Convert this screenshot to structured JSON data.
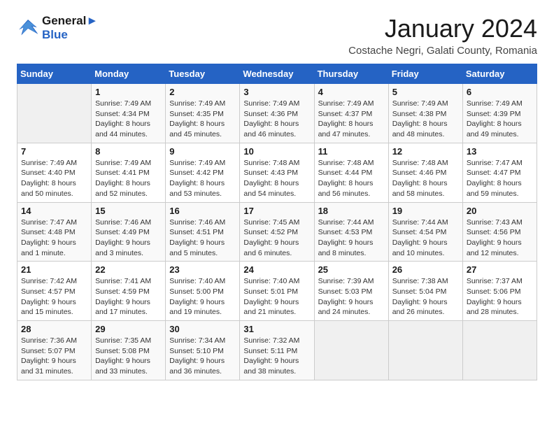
{
  "logo": {
    "line1": "General",
    "line2": "Blue"
  },
  "title": "January 2024",
  "subtitle": "Costache Negri, Galati County, Romania",
  "days_of_week": [
    "Sunday",
    "Monday",
    "Tuesday",
    "Wednesday",
    "Thursday",
    "Friday",
    "Saturday"
  ],
  "weeks": [
    [
      {
        "day": "",
        "content": ""
      },
      {
        "day": "1",
        "content": "Sunrise: 7:49 AM\nSunset: 4:34 PM\nDaylight: 8 hours\nand 44 minutes."
      },
      {
        "day": "2",
        "content": "Sunrise: 7:49 AM\nSunset: 4:35 PM\nDaylight: 8 hours\nand 45 minutes."
      },
      {
        "day": "3",
        "content": "Sunrise: 7:49 AM\nSunset: 4:36 PM\nDaylight: 8 hours\nand 46 minutes."
      },
      {
        "day": "4",
        "content": "Sunrise: 7:49 AM\nSunset: 4:37 PM\nDaylight: 8 hours\nand 47 minutes."
      },
      {
        "day": "5",
        "content": "Sunrise: 7:49 AM\nSunset: 4:38 PM\nDaylight: 8 hours\nand 48 minutes."
      },
      {
        "day": "6",
        "content": "Sunrise: 7:49 AM\nSunset: 4:39 PM\nDaylight: 8 hours\nand 49 minutes."
      }
    ],
    [
      {
        "day": "7",
        "content": "Sunrise: 7:49 AM\nSunset: 4:40 PM\nDaylight: 8 hours\nand 50 minutes."
      },
      {
        "day": "8",
        "content": "Sunrise: 7:49 AM\nSunset: 4:41 PM\nDaylight: 8 hours\nand 52 minutes."
      },
      {
        "day": "9",
        "content": "Sunrise: 7:49 AM\nSunset: 4:42 PM\nDaylight: 8 hours\nand 53 minutes."
      },
      {
        "day": "10",
        "content": "Sunrise: 7:48 AM\nSunset: 4:43 PM\nDaylight: 8 hours\nand 54 minutes."
      },
      {
        "day": "11",
        "content": "Sunrise: 7:48 AM\nSunset: 4:44 PM\nDaylight: 8 hours\nand 56 minutes."
      },
      {
        "day": "12",
        "content": "Sunrise: 7:48 AM\nSunset: 4:46 PM\nDaylight: 8 hours\nand 58 minutes."
      },
      {
        "day": "13",
        "content": "Sunrise: 7:47 AM\nSunset: 4:47 PM\nDaylight: 8 hours\nand 59 minutes."
      }
    ],
    [
      {
        "day": "14",
        "content": "Sunrise: 7:47 AM\nSunset: 4:48 PM\nDaylight: 9 hours\nand 1 minute."
      },
      {
        "day": "15",
        "content": "Sunrise: 7:46 AM\nSunset: 4:49 PM\nDaylight: 9 hours\nand 3 minutes."
      },
      {
        "day": "16",
        "content": "Sunrise: 7:46 AM\nSunset: 4:51 PM\nDaylight: 9 hours\nand 5 minutes."
      },
      {
        "day": "17",
        "content": "Sunrise: 7:45 AM\nSunset: 4:52 PM\nDaylight: 9 hours\nand 6 minutes."
      },
      {
        "day": "18",
        "content": "Sunrise: 7:44 AM\nSunset: 4:53 PM\nDaylight: 9 hours\nand 8 minutes."
      },
      {
        "day": "19",
        "content": "Sunrise: 7:44 AM\nSunset: 4:54 PM\nDaylight: 9 hours\nand 10 minutes."
      },
      {
        "day": "20",
        "content": "Sunrise: 7:43 AM\nSunset: 4:56 PM\nDaylight: 9 hours\nand 12 minutes."
      }
    ],
    [
      {
        "day": "21",
        "content": "Sunrise: 7:42 AM\nSunset: 4:57 PM\nDaylight: 9 hours\nand 15 minutes."
      },
      {
        "day": "22",
        "content": "Sunrise: 7:41 AM\nSunset: 4:59 PM\nDaylight: 9 hours\nand 17 minutes."
      },
      {
        "day": "23",
        "content": "Sunrise: 7:40 AM\nSunset: 5:00 PM\nDaylight: 9 hours\nand 19 minutes."
      },
      {
        "day": "24",
        "content": "Sunrise: 7:40 AM\nSunset: 5:01 PM\nDaylight: 9 hours\nand 21 minutes."
      },
      {
        "day": "25",
        "content": "Sunrise: 7:39 AM\nSunset: 5:03 PM\nDaylight: 9 hours\nand 24 minutes."
      },
      {
        "day": "26",
        "content": "Sunrise: 7:38 AM\nSunset: 5:04 PM\nDaylight: 9 hours\nand 26 minutes."
      },
      {
        "day": "27",
        "content": "Sunrise: 7:37 AM\nSunset: 5:06 PM\nDaylight: 9 hours\nand 28 minutes."
      }
    ],
    [
      {
        "day": "28",
        "content": "Sunrise: 7:36 AM\nSunset: 5:07 PM\nDaylight: 9 hours\nand 31 minutes."
      },
      {
        "day": "29",
        "content": "Sunrise: 7:35 AM\nSunset: 5:08 PM\nDaylight: 9 hours\nand 33 minutes."
      },
      {
        "day": "30",
        "content": "Sunrise: 7:34 AM\nSunset: 5:10 PM\nDaylight: 9 hours\nand 36 minutes."
      },
      {
        "day": "31",
        "content": "Sunrise: 7:32 AM\nSunset: 5:11 PM\nDaylight: 9 hours\nand 38 minutes."
      },
      {
        "day": "",
        "content": ""
      },
      {
        "day": "",
        "content": ""
      },
      {
        "day": "",
        "content": ""
      }
    ]
  ]
}
